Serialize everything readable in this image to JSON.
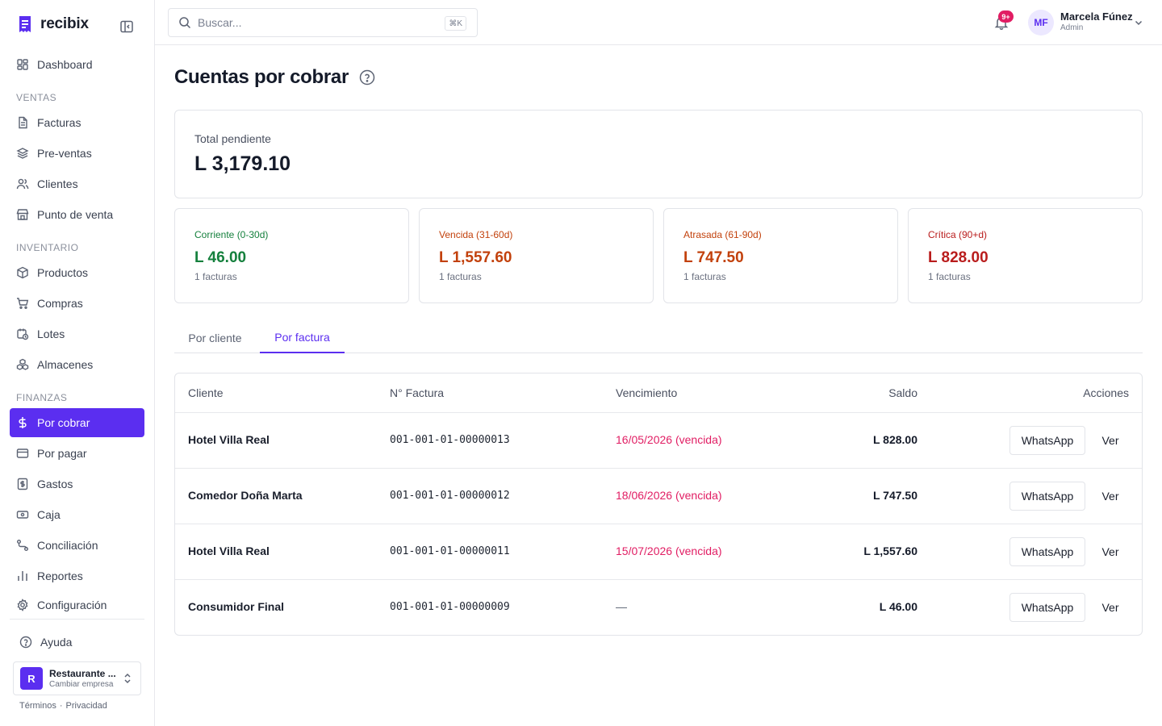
{
  "app": {
    "name": "recibix",
    "brand_color": "#5b2ef0"
  },
  "search": {
    "placeholder": "Buscar...",
    "shortcut": "⌘K"
  },
  "notifications": {
    "badge": "9+"
  },
  "user": {
    "initials": "MF",
    "name": "Marcela Fúnez",
    "role": "Admin"
  },
  "sidebar": {
    "dashboard": "Dashboard",
    "sections": {
      "ventas": "VENTAS",
      "inventario": "INVENTARIO",
      "finanzas": "FINANZAS"
    },
    "items": {
      "facturas": "Facturas",
      "preventas": "Pre-ventas",
      "clientes": "Clientes",
      "pos": "Punto de venta",
      "productos": "Productos",
      "compras": "Compras",
      "lotes": "Lotes",
      "almacenes": "Almacenes",
      "por_cobrar": "Por cobrar",
      "por_pagar": "Por pagar",
      "gastos": "Gastos",
      "caja": "Caja",
      "conciliacion": "Conciliación",
      "reportes": "Reportes",
      "configuracion": "Configuración"
    },
    "help": "Ayuda",
    "company": {
      "initial": "R",
      "name": "Restaurante ...",
      "sub": "Cambiar empresa"
    },
    "legal": {
      "terms": "Términos",
      "sep": "·",
      "privacy": "Privacidad"
    }
  },
  "page": {
    "title": "Cuentas por cobrar"
  },
  "total": {
    "label": "Total pendiente",
    "value": "L 3,179.10"
  },
  "aging": [
    {
      "label": "Corriente (0-30d)",
      "value": "L 46.00",
      "count": "1 facturas",
      "color": "#15803d"
    },
    {
      "label": "Vencida (31-60d)",
      "value": "L 1,557.60",
      "count": "1 facturas",
      "color": "#c2410c"
    },
    {
      "label": "Atrasada (61-90d)",
      "value": "L 747.50",
      "count": "1 facturas",
      "color": "#c2410c"
    },
    {
      "label": "Crítica (90+d)",
      "value": "L 828.00",
      "count": "1 facturas",
      "color": "#b91c1c"
    }
  ],
  "tabs": {
    "by_client": "Por cliente",
    "by_invoice": "Por factura",
    "active": "by_invoice"
  },
  "table": {
    "headers": {
      "client": "Cliente",
      "invoice": "N° Factura",
      "due": "Vencimiento",
      "balance": "Saldo",
      "actions": "Acciones"
    },
    "rows": [
      {
        "client": "Hotel Villa Real",
        "invoice": "001-001-01-00000013",
        "due": "16/05/2026 (vencida)",
        "balance": "L 828.00",
        "overdue": true
      },
      {
        "client": "Comedor Doña Marta",
        "invoice": "001-001-01-00000012",
        "due": "18/06/2026 (vencida)",
        "balance": "L 747.50",
        "overdue": true
      },
      {
        "client": "Hotel Villa Real",
        "invoice": "001-001-01-00000011",
        "due": "15/07/2026 (vencida)",
        "balance": "L 1,557.60",
        "overdue": true
      },
      {
        "client": "Consumidor Final",
        "invoice": "001-001-01-00000009",
        "due": "—",
        "balance": "L 46.00",
        "overdue": false
      }
    ],
    "actions": {
      "whatsapp": "WhatsApp",
      "view": "Ver"
    }
  }
}
